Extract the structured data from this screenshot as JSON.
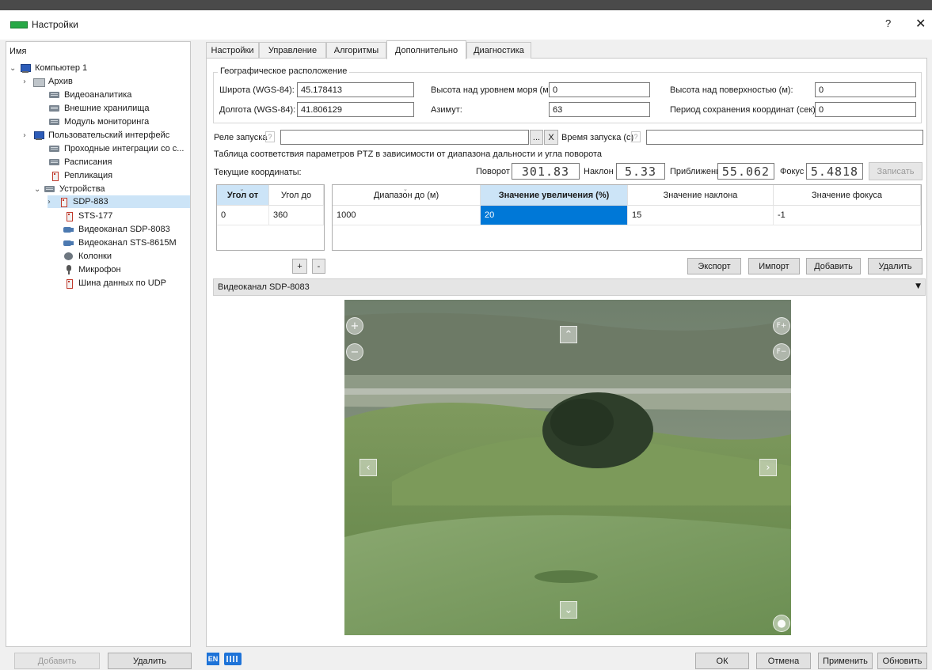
{
  "window": {
    "title": "Настройки",
    "help_label": "?",
    "close_label": "✕"
  },
  "tree": {
    "header": "Имя",
    "items": [
      {
        "label": "Компьютер 1",
        "icon": "computer-icon",
        "expanded": true
      },
      {
        "label": "Архив",
        "icon": "archive-icon"
      },
      {
        "label": "Видеоаналитика",
        "icon": "server-icon"
      },
      {
        "label": "Внешние хранилища",
        "icon": "server-icon"
      },
      {
        "label": "Модуль мониторинга",
        "icon": "server-icon"
      },
      {
        "label": "Пользовательский интерфейс",
        "icon": "computer-icon"
      },
      {
        "label": "Проходные интеграции со с...",
        "icon": "server-icon"
      },
      {
        "label": "Расписания",
        "icon": "server-icon"
      },
      {
        "label": "Репликация",
        "icon": "camera-icon"
      },
      {
        "label": "Устройства",
        "icon": "server-icon",
        "expanded": true
      },
      {
        "label": "SDP-883",
        "icon": "camera-icon",
        "selected": true
      },
      {
        "label": "STS-177",
        "icon": "camera-icon"
      },
      {
        "label": "Видеоканал SDP-8083",
        "icon": "video-icon"
      },
      {
        "label": "Видеоканал STS-8615M",
        "icon": "video-icon"
      },
      {
        "label": "Колонки",
        "icon": "speaker-icon"
      },
      {
        "label": "Микрофон",
        "icon": "microphone-icon"
      },
      {
        "label": "Шина данных по UDP",
        "icon": "camera-icon"
      }
    ],
    "add_label": "Добавить",
    "delete_label": "Удалить"
  },
  "tabs": [
    {
      "label": "Настройки"
    },
    {
      "label": "Управление"
    },
    {
      "label": "Алгоритмы"
    },
    {
      "label": "Дополнительно",
      "active": true
    },
    {
      "label": "Диагностика"
    }
  ],
  "geo": {
    "title": "Географическое расположение",
    "lat_label": "Широта (WGS-84):",
    "lat_value": "45.178413",
    "lon_label": "Долгота (WGS-84):",
    "lon_value": "41.806129",
    "alt_sea_label": "Высота над уровнем моря (м):",
    "alt_sea_value": "0",
    "azimuth_label": "Азимут:",
    "azimuth_value": "63",
    "alt_surface_label": "Высота над поверхностью (м):",
    "alt_surface_value": "0",
    "save_period_label": "Период сохранения координат (сек):",
    "save_period_value": "0"
  },
  "relay": {
    "label": "Реле запуска",
    "help": "?",
    "value": "",
    "browse_label": "...",
    "clear_label": "X",
    "time_label": "Время запуска (с)",
    "time_value": ""
  },
  "ptz": {
    "table_caption": "Таблица соответствия параметров PTZ в зависимости от диапазона дальности и угла поворота",
    "current_label": "Текущие координаты:",
    "pan_label": "Поворот",
    "pan_value": "301.83",
    "tilt_label": "Наклон",
    "tilt_value": "5.33",
    "zoom_label": "Приближение",
    "zoom_value": "55.062",
    "focus_label": "Фокус",
    "focus_value": "5.4818",
    "record_label": "Записать"
  },
  "angle_table": {
    "columns": [
      "Угол от",
      "Угол до"
    ],
    "rows": [
      [
        "0",
        "360"
      ]
    ],
    "add_label": "+",
    "remove_label": "-"
  },
  "range_table": {
    "columns": [
      "Диапазон до (м)",
      "Значение увеличения (%)",
      "Значение наклона",
      "Значение фокуса"
    ],
    "rows": [
      [
        "1000",
        "20",
        "15",
        "-1"
      ]
    ]
  },
  "range_buttons": {
    "export": "Экспорт",
    "import": "Импорт",
    "add": "Добавить",
    "delete": "Удалить"
  },
  "video_channel": {
    "selected": "Видеоканал SDP-8083"
  },
  "footer": {
    "lang": "EN",
    "ok": "ОК",
    "cancel": "Отмена",
    "apply": "Применить",
    "refresh": "Обновить"
  },
  "colors": {
    "selection": "#0078d7",
    "sorted_header": "#cce4f7",
    "title_icon": "#27a846"
  }
}
